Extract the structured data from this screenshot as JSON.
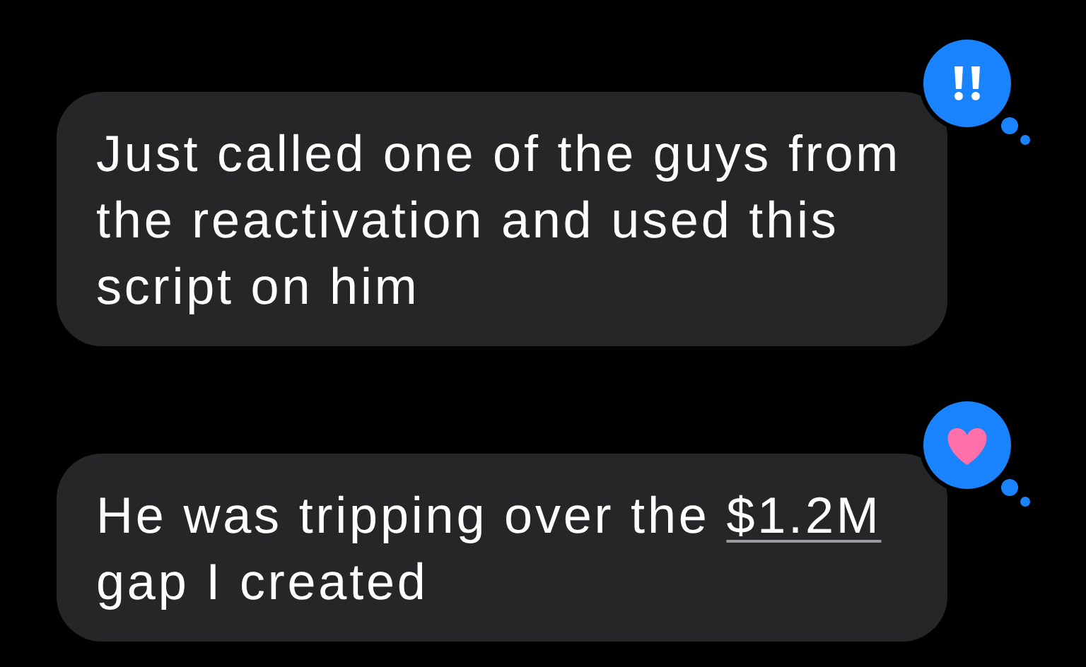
{
  "messages": [
    {
      "parts": [
        {
          "kind": "text",
          "text": "Just called one of the guys from the reactivation and used this script on him"
        }
      ],
      "reaction": {
        "kind": "exclamation"
      }
    },
    {
      "parts": [
        {
          "kind": "text",
          "text": "He was tripping over the "
        },
        {
          "kind": "link",
          "text": "$1.2M"
        },
        {
          "kind": "text",
          "text": " gap I created"
        }
      ],
      "reaction": {
        "kind": "heart"
      }
    }
  ]
}
